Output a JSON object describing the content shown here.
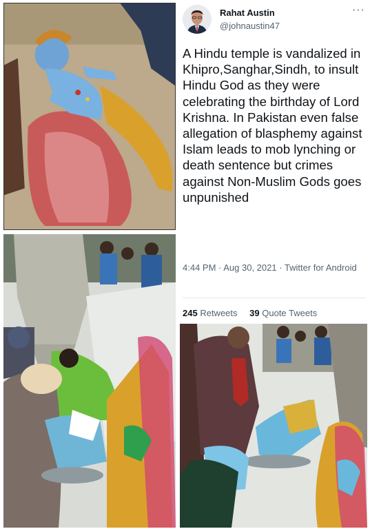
{
  "tweet": {
    "author_name": "Rahat Austin",
    "author_handle": "@johnaustin47",
    "more_glyph": "···",
    "text": "A Hindu temple is vandalized in Khipro,Sanghar,Sindh, to insult Hindu God as they were celebrating the birthday of Lord Krishna. In Pakistan even false allegation of blasphemy against Islam leads to mob lynching or death sentence but crimes against Non-Muslim Gods goes unpunished",
    "meta": "4:44 PM · Aug 30, 2021 · Twitter for Android",
    "stats": {
      "retweets_count": "245",
      "retweets_label": "Retweets",
      "quotes_count": "39",
      "quotes_label": "Quote Tweets"
    }
  },
  "colors": {
    "text": "#0f1419",
    "secondary": "#536471",
    "divider": "#e1e6ea"
  }
}
